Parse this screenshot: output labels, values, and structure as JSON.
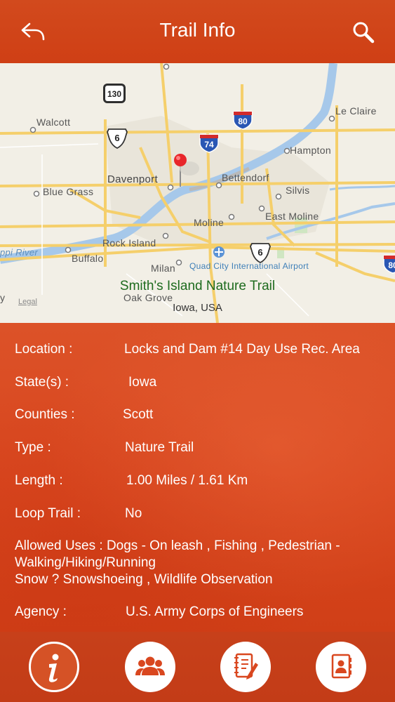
{
  "header": {
    "title": "Trail Info",
    "back_icon": "back-arrow-icon",
    "search_icon": "search-icon"
  },
  "map": {
    "trail_name": "Smith's Island Nature Trail",
    "trail_state": "Iowa, USA",
    "legal": "Legal",
    "labels": {
      "walcott": "Walcott",
      "le_claire": "Le Claire",
      "hampton": "Hampton",
      "davenport": "Davenport",
      "bettendorf": "Bettendorf",
      "silvis": "Silvis",
      "blue_grass": "Blue Grass",
      "east_moline": "East Moline",
      "moline": "Moline",
      "rock_island": "Rock Island",
      "river": "ppi River",
      "buffalo": "Buffalo",
      "milan": "Milan",
      "airport": "Quad City International Airport",
      "oak_grove": "Oak Grove",
      "edge_y": "y"
    },
    "shields": {
      "state_130": "130",
      "us_6_a": "6",
      "us_6_b": "6",
      "i_80_a": "80",
      "i_74": "74",
      "i_80_b": "80"
    },
    "colors": {
      "land": "#f2efe6",
      "water": "#a6c8ea",
      "road": "#f5cf6b",
      "pin": "#e8262b"
    }
  },
  "details": {
    "location_label": "Location  :",
    "location_value": "Locks and Dam #14 Day Use Rec. Area",
    "states_label": "State(s)  :",
    "states_value": "Iowa",
    "counties_label": "Counties  :",
    "counties_value": "Scott",
    "type_label": "Type  :",
    "type_value": "Nature Trail",
    "length_label": "Length  :",
    "length_value": "1.00 Miles / 1.61 Km",
    "loop_label": "Loop Trail  :",
    "loop_value": "No",
    "uses_line1": "Allowed Uses  :  Dogs - On leash , Fishing , Pedestrian -",
    "uses_line2": "Walking/Hiking/Running",
    "uses_line3": "Snow ? Snowshoeing , Wildlife Observation",
    "agency_label": "Agency  :",
    "agency_value": "U.S. Army Corps of Engineers"
  },
  "tabs": [
    {
      "name": "info",
      "icon": "info-icon",
      "active": true
    },
    {
      "name": "people",
      "icon": "group-icon",
      "active": false
    },
    {
      "name": "notes",
      "icon": "notepad-icon",
      "active": false
    },
    {
      "name": "contacts",
      "icon": "contact-book-icon",
      "active": false
    }
  ],
  "theme": {
    "primary": "#d24a1d",
    "tab_bar": "#c33c17"
  }
}
